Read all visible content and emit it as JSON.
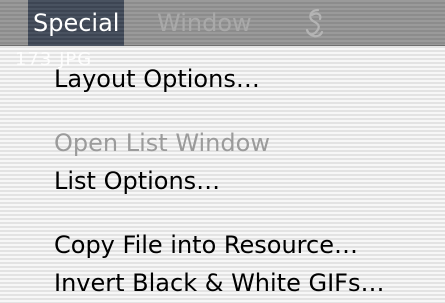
{
  "menubar": {
    "special_label": "Special",
    "window_label": "Window",
    "script_icon": "script-icon"
  },
  "background_ghost_text": "173 JPG",
  "menu": {
    "items": [
      {
        "label": "Layout Options…",
        "enabled": true
      },
      {
        "label": "Open List Window",
        "enabled": false
      },
      {
        "label": "List Options…",
        "enabled": true
      },
      {
        "label": "Copy File into Resource…",
        "enabled": true
      },
      {
        "label": "Invert Black & White GIFs…",
        "enabled": true
      }
    ]
  },
  "colors": {
    "highlight": "#3d4553",
    "menubar": "#8c8c8c",
    "disabled_text": "#9b9b9b"
  }
}
